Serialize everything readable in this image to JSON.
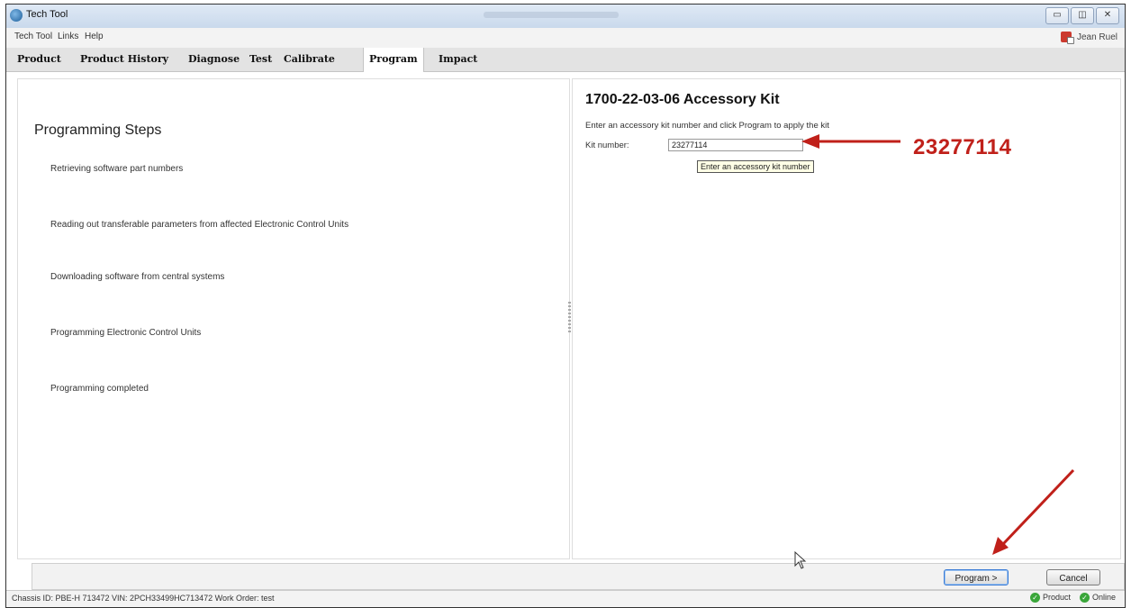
{
  "window": {
    "title": "Tech Tool"
  },
  "menu": [
    "Tech Tool",
    "Links",
    "Help"
  ],
  "user": {
    "name": "Jean Ruel"
  },
  "tabs": [
    "Product",
    "Product History",
    "Diagnose",
    "Test",
    "Calibrate",
    "Program",
    "Impact"
  ],
  "active_tab": "Program",
  "left": {
    "title": "Programming Steps",
    "steps": [
      "Retrieving software part numbers",
      "Reading out transferable parameters from affected Electronic Control Units",
      "Downloading software from central systems",
      "Programming Electronic Control Units",
      "Programming completed"
    ]
  },
  "right": {
    "title": "1700-22-03-06 Accessory Kit",
    "description": "Enter an accessory kit number and click Program to apply the kit",
    "kit_label": "Kit number:",
    "kit_value": "23277114",
    "tooltip": "Enter an accessory kit number"
  },
  "buttons": {
    "program": "Program >",
    "cancel": "Cancel"
  },
  "status": {
    "text": "Chassis ID: PBE-H 713472    VIN: 2PCH33499HC713472    Work Order: test",
    "product": "Product",
    "online": "Online"
  },
  "annotation": {
    "number": "23277114",
    "color": "#c0201a"
  }
}
